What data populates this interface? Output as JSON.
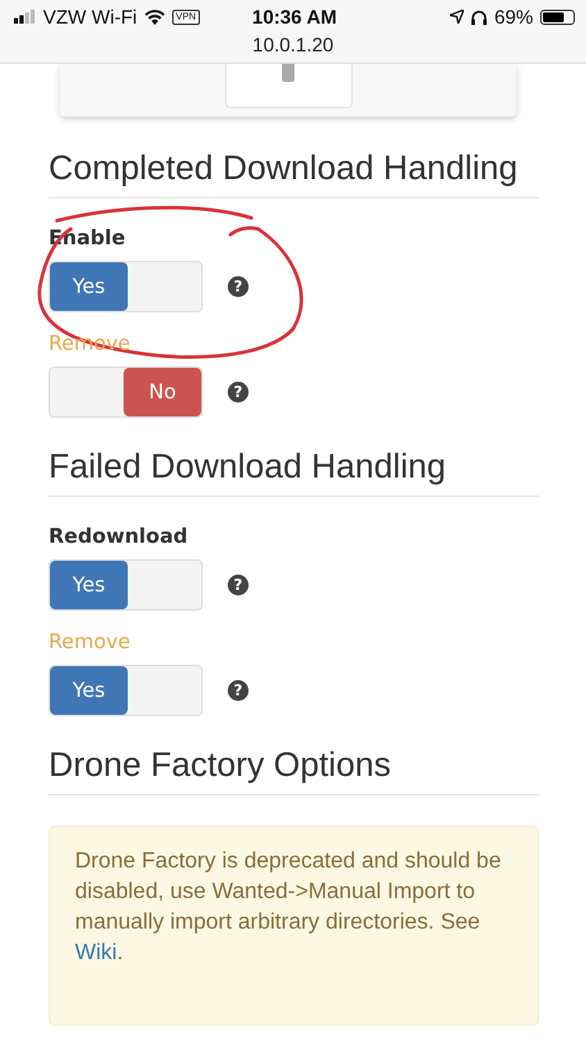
{
  "status_bar": {
    "carrier": "VZW Wi-Fi",
    "vpn": "VPN",
    "time": "10:36 AM",
    "address": "10.0.1.20",
    "battery": "69%"
  },
  "sections": [
    {
      "title": "Completed Download Handling",
      "fields": [
        {
          "label": "Enable",
          "advanced": false,
          "on": true,
          "value": "Yes",
          "help": "?",
          "circled": true
        },
        {
          "label": "Remove",
          "advanced": true,
          "on": false,
          "value": "No",
          "help": "?"
        }
      ]
    },
    {
      "title": "Failed Download Handling",
      "fields": [
        {
          "label": "Redownload",
          "advanced": false,
          "on": true,
          "value": "Yes",
          "help": "?"
        },
        {
          "label": "Remove",
          "advanced": true,
          "on": true,
          "value": "Yes",
          "help": "?"
        }
      ]
    },
    {
      "title": "Drone Factory Options",
      "notice": {
        "text": "Drone Factory is deprecated and should be disabled, use Wanted->Manual Import to manually import arbitrary directories. See ",
        "link": "Wiki",
        "tail": "."
      }
    }
  ]
}
